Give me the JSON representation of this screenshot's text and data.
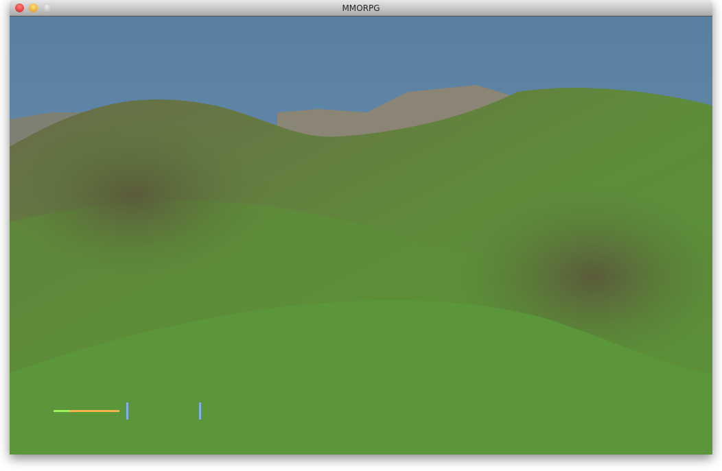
{
  "window": {
    "title": "MMORPG"
  },
  "hud": {
    "health_bar": {
      "level": 0.25
    }
  }
}
